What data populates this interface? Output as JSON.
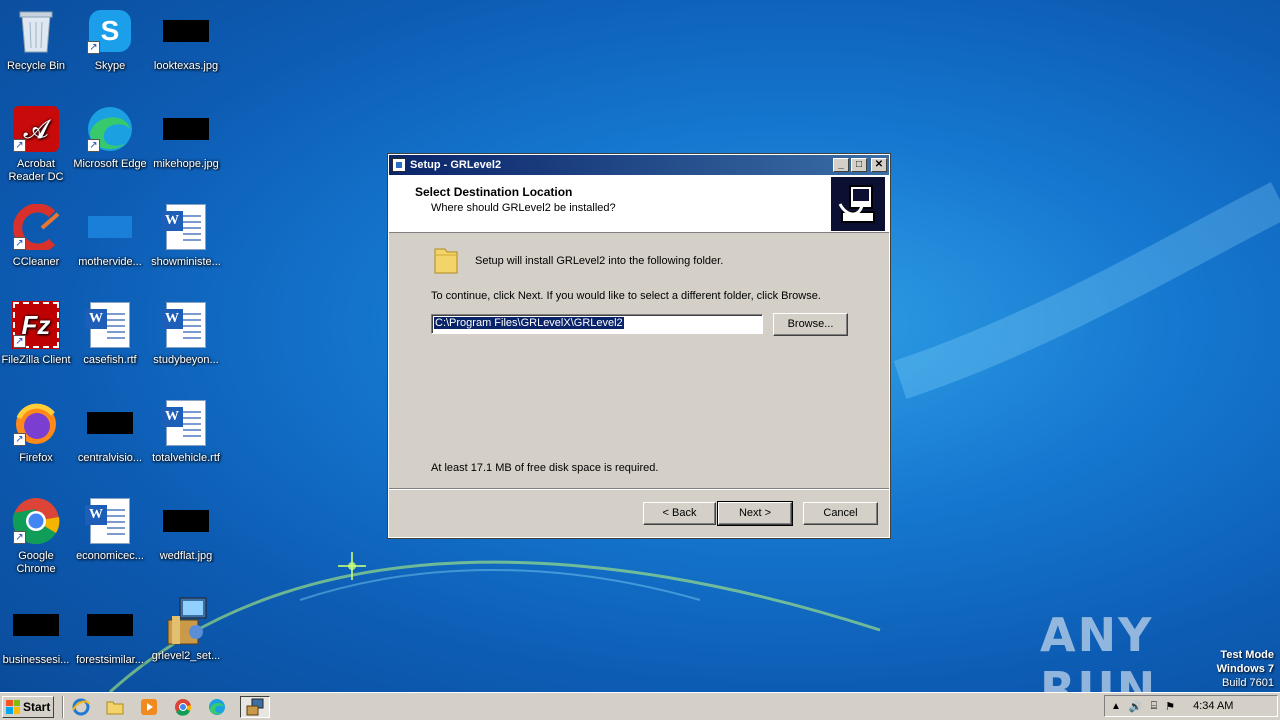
{
  "desktop": {
    "icons": [
      {
        "label": "Recycle Bin"
      },
      {
        "label": "Skype"
      },
      {
        "label": "looktexas.jpg"
      },
      {
        "label": "Acrobat Reader DC"
      },
      {
        "label": "Microsoft Edge"
      },
      {
        "label": "mikehope.jpg"
      },
      {
        "label": "CCleaner"
      },
      {
        "label": "mothervide..."
      },
      {
        "label": "showministe..."
      },
      {
        "label": "FileZilla Client"
      },
      {
        "label": "casefish.rtf"
      },
      {
        "label": "studybeyon..."
      },
      {
        "label": "Firefox"
      },
      {
        "label": "centralvisio..."
      },
      {
        "label": "totalvehicle.rtf"
      },
      {
        "label": "Google Chrome"
      },
      {
        "label": "economicec..."
      },
      {
        "label": "wedflat.jpg"
      },
      {
        "label": "businessesi..."
      },
      {
        "label": "forestsimilar..."
      },
      {
        "label": "grlevel2_set..."
      }
    ]
  },
  "dialog": {
    "title": "Setup - GRLevel2",
    "header_title": "Select Destination Location",
    "header_subtitle": "Where should GRLevel2 be installed?",
    "install_info": "Setup will install GRLevel2 into the following folder.",
    "instructions": "To continue, click Next. If you would like to select a different folder, click Browse.",
    "path_value": "C:\\Program Files\\GRLevelX\\GRLevel2",
    "browse_label": "Browse...",
    "disk_space": "At least 17.1 MB of free disk space is required.",
    "back_label": "< Back",
    "next_label": "Next >",
    "cancel_label": "Cancel"
  },
  "watermark": {
    "text": "ANY RUN"
  },
  "os_info": {
    "line1": "Test Mode",
    "line2": "Windows 7",
    "line3": "Build 7601"
  },
  "taskbar": {
    "start_label": "Start",
    "clock": "4:34 AM"
  }
}
